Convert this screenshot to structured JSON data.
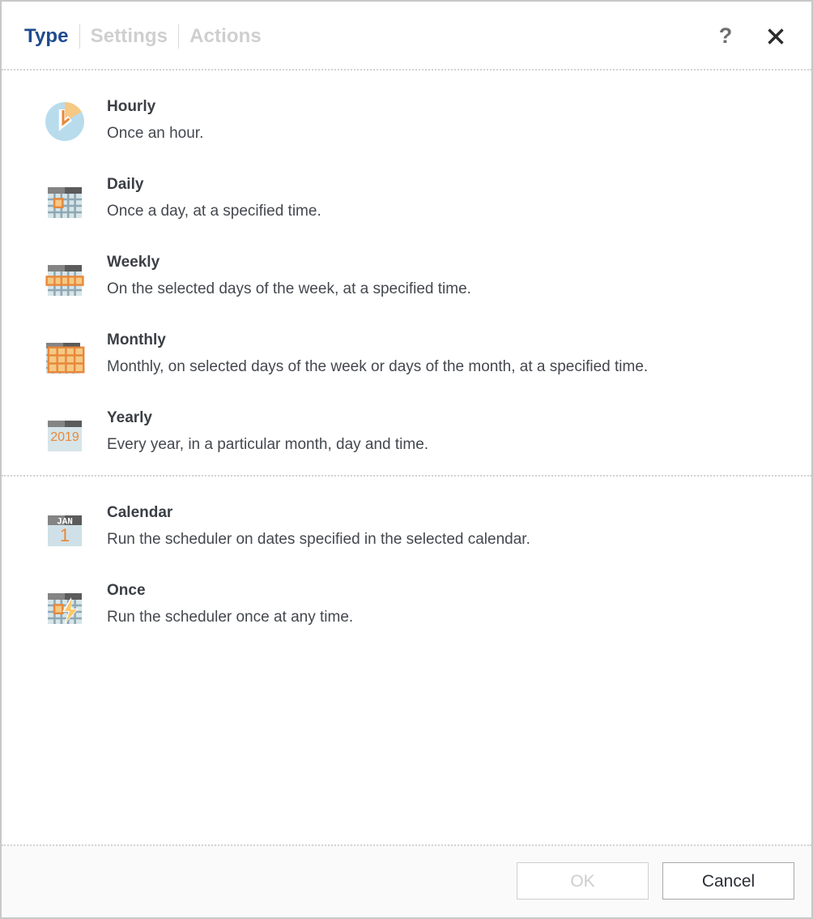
{
  "dialog": {
    "tabs": [
      {
        "label": "Type",
        "active": true
      },
      {
        "label": "Settings",
        "active": false
      },
      {
        "label": "Actions",
        "active": false
      }
    ],
    "help_label": "?",
    "close_label": "✕"
  },
  "groups": [
    {
      "name": "recurring",
      "options": [
        {
          "icon": "clock-hourly-icon",
          "title": "Hourly",
          "desc": "Once an hour."
        },
        {
          "icon": "calendar-daily-icon",
          "title": "Daily",
          "desc": "Once a day, at a specified time."
        },
        {
          "icon": "calendar-weekly-icon",
          "title": "Weekly",
          "desc": "On the selected days of the week, at a specified time."
        },
        {
          "icon": "calendar-monthly-icon",
          "title": "Monthly",
          "desc": "Monthly, on selected days of the week or days of the month, at a specified time."
        },
        {
          "icon": "calendar-yearly-icon",
          "title": "Yearly",
          "desc": "Every year, in a particular month, day and time."
        }
      ]
    },
    {
      "name": "one-off",
      "options": [
        {
          "icon": "calendar-page-icon",
          "title": "Calendar",
          "desc": "Run the scheduler on dates specified in the selected calendar."
        },
        {
          "icon": "calendar-once-icon",
          "title": "Once",
          "desc": "Run the scheduler once at any time."
        }
      ]
    }
  ],
  "icon_text": {
    "yearly_year": "2019",
    "calendar_month": "JAN",
    "calendar_day": "1"
  },
  "footer": {
    "ok_label": "OK",
    "ok_disabled": true,
    "cancel_label": "Cancel"
  },
  "colors": {
    "active_tab": "#1f4b8e",
    "inactive_tab": "#cfcfcf",
    "accent_orange": "#e8883a",
    "accent_orange_light": "#f5c884",
    "icon_blue": "#b8dcec",
    "icon_blue_pale": "#d7e5e9",
    "icon_gray_light": "#848484",
    "icon_gray_dark": "#5b5b5b",
    "grid_line": "#8fa8b5"
  }
}
